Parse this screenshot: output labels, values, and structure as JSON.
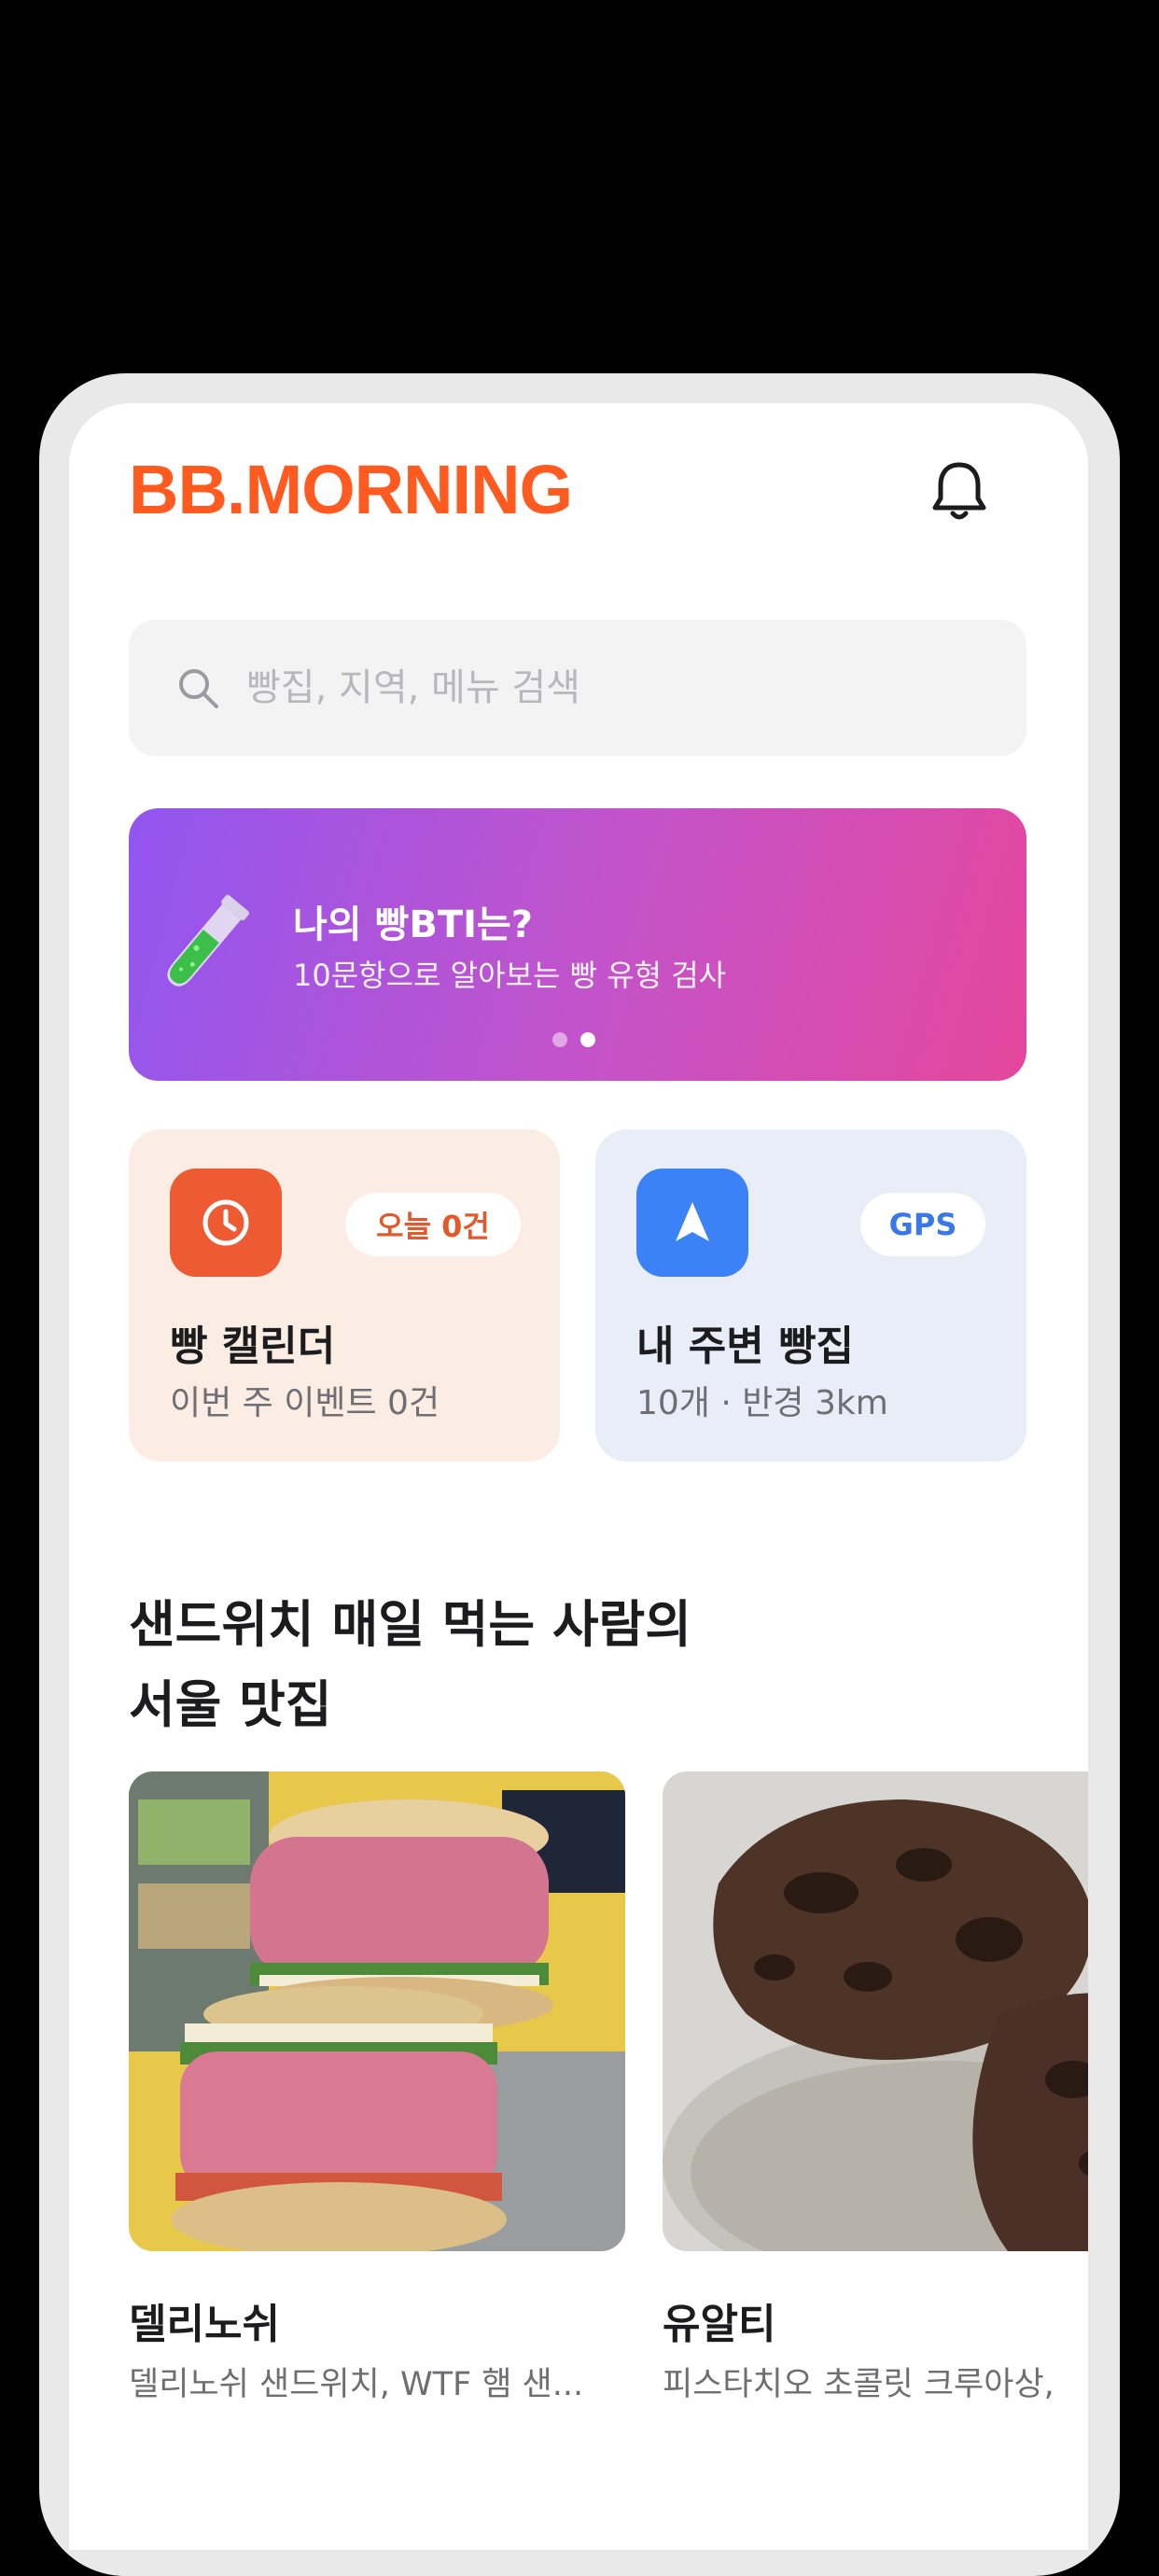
{
  "app": {
    "logo": "BB.MORNING"
  },
  "header": {
    "notification_icon": "bell-icon"
  },
  "search": {
    "placeholder": "빵집, 지역, 메뉴 검색",
    "icon": "search-icon"
  },
  "banner": {
    "title": "나의 빵BTI는?",
    "subtitle": "10문항으로 알아보는 빵 유형 검사",
    "icon": "test-tube-icon",
    "page_indicator": {
      "count": 2,
      "active_index": 1
    },
    "gradient": [
      "#9156f0",
      "#e5479c"
    ]
  },
  "cards": {
    "calendar": {
      "icon": "clock-icon",
      "badge": "오늘 0건",
      "title": "빵 캘린더",
      "subtitle": "이번 주 이벤트 0건"
    },
    "nearby": {
      "icon": "navigation-arrow-icon",
      "badge": "GPS",
      "title": "내 주변 빵집",
      "subtitle": "10개 · 반경 3km"
    }
  },
  "section": {
    "title_line1": "샌드위치 매일 먹는 사람의",
    "title_line2": "서울 맛집"
  },
  "shops": [
    {
      "name": "델리노쉬",
      "description": "델리노쉬 샌드위치, WTF 햄 샌..."
    },
    {
      "name": "유알티",
      "description": "피스타치오 초콜릿 크루아상, "
    }
  ],
  "colors": {
    "brand": "#ff5a1f",
    "calendar_accent": "#ee5a32",
    "nearby_accent": "#3b82f6"
  }
}
